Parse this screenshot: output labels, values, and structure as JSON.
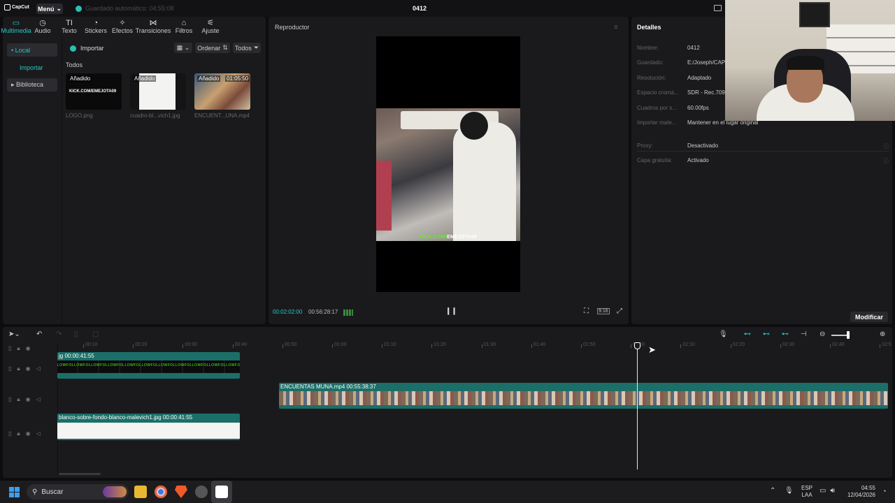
{
  "app": {
    "logo_text": "CapCut",
    "menu_label": "Menú",
    "autosave_text": "Guardado automático: 04:55:08",
    "project_title": "0412"
  },
  "toolbar": {
    "tabs": [
      {
        "label": "Multimedia",
        "icon": "media-icon",
        "glyph": "▭"
      },
      {
        "label": "Audio",
        "icon": "audio-icon",
        "glyph": "◷"
      },
      {
        "label": "Texto",
        "icon": "text-icon",
        "glyph": "TI"
      },
      {
        "label": "Stickers",
        "icon": "stickers-icon",
        "glyph": "◔"
      },
      {
        "label": "Efectos",
        "icon": "effects-icon",
        "glyph": "✧"
      },
      {
        "label": "Transiciones",
        "icon": "transitions-icon",
        "glyph": "⋈"
      },
      {
        "label": "Filtros",
        "icon": "filters-icon",
        "glyph": "⌂"
      },
      {
        "label": "Ajuste",
        "icon": "adjust-icon",
        "glyph": "⚟"
      }
    ]
  },
  "sidebar": {
    "local": "• Local",
    "import": "Importar",
    "library": "▸ Biblioteca"
  },
  "media": {
    "import_label": "Importar",
    "sort_label": "Ordenar",
    "all_label": "Todos",
    "section_label": "Todos",
    "items": [
      {
        "badge": "Añadido",
        "name": "LOGO.png",
        "duration": ""
      },
      {
        "badge": "Añadido",
        "name": "cuadro-bl...vich1.jpg",
        "duration": ""
      },
      {
        "badge": "Añadido",
        "name": "ENCUENT...UNA.mp4",
        "duration": "01:05:50"
      }
    ],
    "logo_thumb_text": "KICK.COM/EMEJOTA09"
  },
  "player": {
    "title": "Reproductor",
    "caption_prefix": "KICK.COM/",
    "caption_suffix": "EMEJOTA09",
    "time_current": "00:02:02:00",
    "time_total": "00:56:28:17",
    "ratio_label": "9:16"
  },
  "details": {
    "title": "Detalles",
    "rows": [
      {
        "label": "Nombre:",
        "value": "0412"
      },
      {
        "label": "Guardado:",
        "value": "E:/Joseph/CAPCUT"
      },
      {
        "label": "Resolución:",
        "value": "Adaptado"
      },
      {
        "label": "Espacio cromá...",
        "value": "SDR - Rec.709"
      },
      {
        "label": "Cuadros por s...",
        "value": "60.00fps"
      },
      {
        "label": "Importar mate...",
        "value": "Mantener en el lugar original"
      }
    ],
    "rows2": [
      {
        "label": "Proxy:",
        "value": "Desactivado"
      },
      {
        "label": "Capa gratuita:",
        "value": "Activado"
      }
    ],
    "modify_label": "Modificar"
  },
  "timeline": {
    "ruler": [
      "00:10",
      "00:20",
      "00:30",
      "00:40",
      "00:50",
      "01:00",
      "01:10",
      "01:20",
      "01:30",
      "01:40",
      "01:50",
      "02:00",
      "02:10",
      "02:20",
      "02:30",
      "02:40",
      "02:5"
    ],
    "clips": {
      "logo": {
        "label": "jg  00:00:41:55",
        "strip_text": "LOWFOLLOWFOLLOWFOLLOWFOLLOWFOLLOWFOLLOWFOLLOWFOLLOWFOLLOWFOLLOWFOLLOW"
      },
      "video": {
        "label": "ENCUENTAS MUNA.mp4  00:55:38:37"
      },
      "white": {
        "label": "blanco-sobre-fondo-blanco-malevich1.jpg  00:00:41:55"
      }
    }
  },
  "taskbar": {
    "search_placeholder": "Buscar",
    "lang_top": "ESP",
    "lang_bottom": "LAA",
    "time": "04:55",
    "date": "12/04/2026"
  }
}
